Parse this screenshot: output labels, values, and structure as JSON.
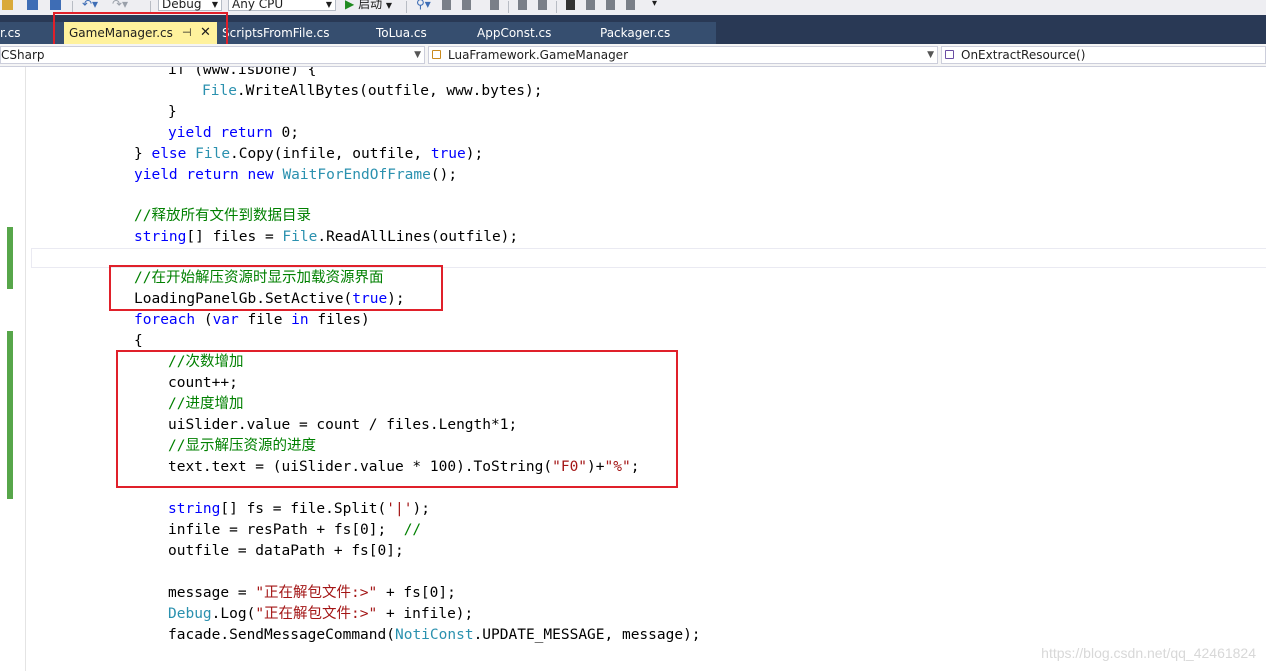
{
  "toolbar": {
    "config": "Debug",
    "platform": "Any CPU",
    "start_label": "启动",
    "colors": {
      "bg": "#eeeef2",
      "play": "#1f8a1f"
    }
  },
  "tabs": [
    {
      "label": "r.cs",
      "active": false
    },
    {
      "label": "GameManager.cs",
      "active": true
    },
    {
      "label": "ScriptsFromFile.cs",
      "active": false
    },
    {
      "label": "ToLua.cs",
      "active": false
    },
    {
      "label": "AppConst.cs",
      "active": false
    },
    {
      "label": "Packager.cs",
      "active": false
    }
  ],
  "tab_icons": {
    "pin": "pin-icon",
    "close": "close-icon"
  },
  "nav": {
    "project": "CSharp",
    "type": "LuaFramework.GameManager",
    "member": "OnExtractResource()"
  },
  "code_colors": {
    "keyword": "#0000ff",
    "type": "#2b91af",
    "comment": "#008000",
    "string": "#a31515",
    "highlight_box": "#e0202a"
  },
  "code": {
    "l1": {
      "a": "if (www.isDone) {"
    },
    "l2": {
      "t": "File",
      "b": ".WriteAllBytes(outfile, www.bytes);"
    },
    "l3": {
      "a": "}"
    },
    "l4": {
      "k1": "yield",
      "k2": "return",
      "b": " 0;"
    },
    "l5": {
      "a": "} ",
      "k": "else",
      "t": "File",
      "b": ".Copy(infile, outfile, ",
      "k2": "true",
      "c": ");"
    },
    "l6": {
      "k1": "yield",
      "k2": "return",
      "k3": "new",
      "t": "WaitForEndOfFrame",
      "b": "();"
    },
    "l8": {
      "cm": "//释放所有文件到数据目录"
    },
    "l9": {
      "k": "string",
      "a": "[] files = ",
      "t": "File",
      "b": ".ReadAllLines(outfile);"
    },
    "l11": {
      "cm": "//在开始解压资源时显示加载资源界面"
    },
    "l12": {
      "a": "LoadingPanelGb.SetActive(",
      "k": "true",
      "b": ");"
    },
    "l13": {
      "k1": "foreach",
      "k2": "var",
      "k3": "in",
      "a": " (",
      "b": " file ",
      "c": " files)"
    },
    "l14": {
      "a": "{"
    },
    "l15": {
      "cm": "//次数增加"
    },
    "l16": {
      "a": "count++;"
    },
    "l17": {
      "cm": "//进度增加"
    },
    "l18": {
      "a": "uiSlider.value = count / files.Length*1;"
    },
    "l19": {
      "cm": "//显示解压资源的进度"
    },
    "l20": {
      "a": "text.text = (uiSlider.value * 100).ToString(",
      "s1": "\"F0\"",
      "b": ")+",
      "s2": "\"%\"",
      "c": ";"
    },
    "l22": {
      "k": "string",
      "a": "[] fs = file.Split(",
      "s": "'|'",
      "b": ");"
    },
    "l23": {
      "a": "infile = resPath + fs[0];  ",
      "cm": "//"
    },
    "l24": {
      "a": "outfile = dataPath + fs[0];"
    },
    "l26": {
      "a": "message = ",
      "s": "\"正在解包文件:>\"",
      "b": " + fs[0];"
    },
    "l27": {
      "t": "Debug",
      "a": ".Log(",
      "s": "\"正在解包文件:>\"",
      "b": " + infile);"
    },
    "l28": {
      "a": "facade.SendMessageCommand(",
      "t": "NotiConst",
      "b": ".UPDATE_MESSAGE, message);"
    }
  },
  "watermark": "https://blog.csdn.net/qq_42461824"
}
